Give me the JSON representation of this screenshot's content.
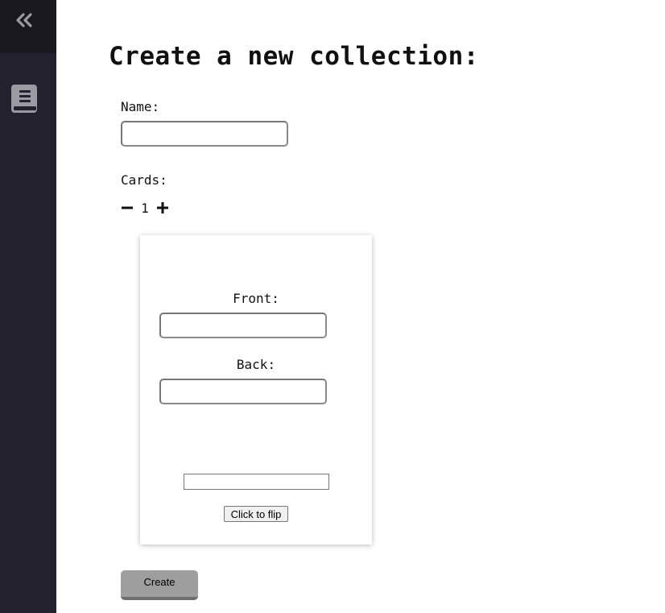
{
  "sidebar": {
    "collapse_icon": "double-chevron-left-icon",
    "collection_icon": "book-icon",
    "background_color": "#23212e",
    "top_color": "#19181f",
    "icon_color": "#9a9aa0"
  },
  "form": {
    "title": "Create a new collection:",
    "name_label": "Name:",
    "name_value": "",
    "cards_label": "Cards:",
    "card_count": "1",
    "decrement_icon": "minus-icon",
    "increment_icon": "plus-icon",
    "create_label": "Create"
  },
  "card": {
    "front_label": "Front:",
    "front_value": "",
    "back_label": "Back:",
    "back_value": "",
    "flip_input_value": "",
    "flip_label": "Click to flip"
  }
}
